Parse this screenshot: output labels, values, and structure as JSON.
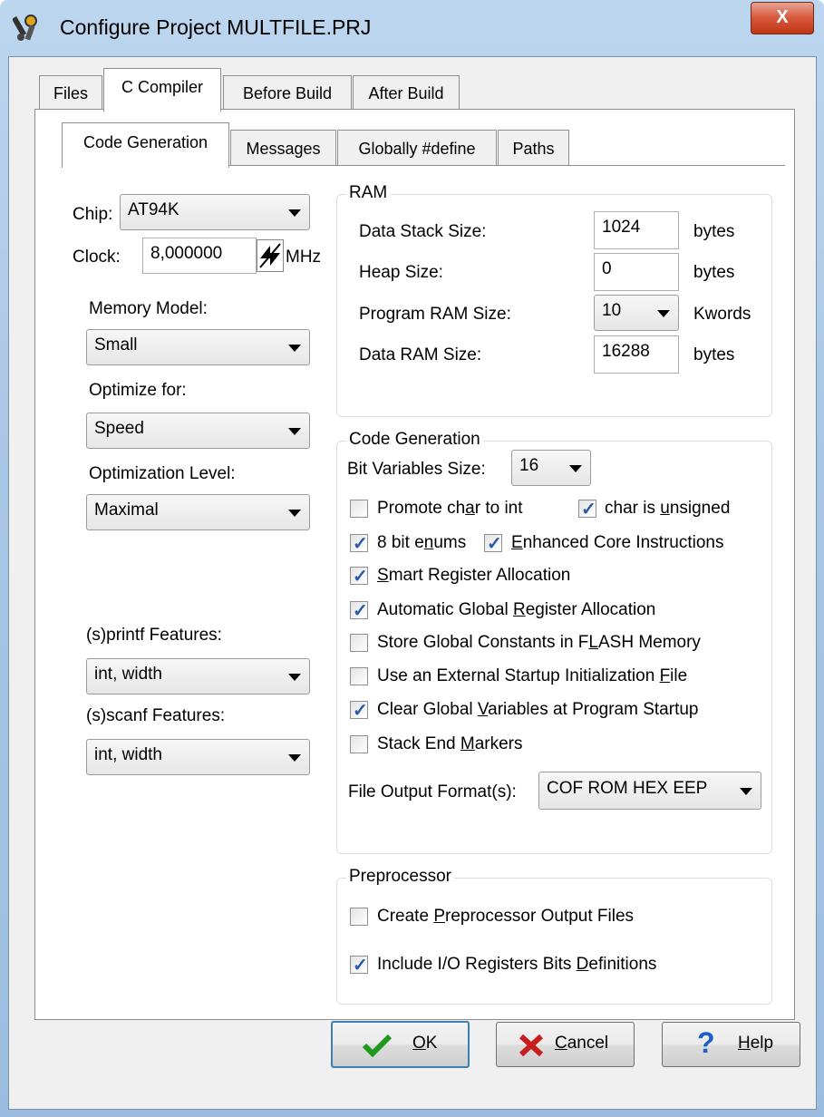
{
  "window": {
    "title": "Configure Project MULTFILE.PRJ",
    "close_glyph": "X"
  },
  "outer_tabs": [
    {
      "label": "Files"
    },
    {
      "label": "C Compiler"
    },
    {
      "label": "Before Build"
    },
    {
      "label": "After Build"
    }
  ],
  "inner_tabs": [
    {
      "label": "Code Generation"
    },
    {
      "label": "Messages"
    },
    {
      "label": "Globally #define"
    },
    {
      "label": "Paths"
    }
  ],
  "left": {
    "chip_label": "Chip:",
    "chip_value": "AT94K",
    "clock_label": "Clock:",
    "clock_value": "8,000000",
    "clock_unit": "MHz",
    "memory_model_label": "Memory Model:",
    "memory_model_value": "Small",
    "optimize_for_label": "Optimize for:",
    "optimize_for_value": "Speed",
    "opt_level_label": "Optimization Level:",
    "opt_level_value": "Maximal",
    "printf_label": "(s)printf Features:",
    "printf_value": "int, width",
    "scanf_label": "(s)scanf Features:",
    "scanf_value": "int, width"
  },
  "ram": {
    "title": "RAM",
    "rows": [
      {
        "label": "Data Stack Size:",
        "value": "1024",
        "unit": "bytes"
      },
      {
        "label": "Heap Size:",
        "value": "0",
        "unit": "bytes"
      },
      {
        "label": "Program RAM Size:",
        "value": "10",
        "unit": "Kwords"
      },
      {
        "label": "Data RAM Size:",
        "value": "16288",
        "unit": "bytes"
      }
    ]
  },
  "codegen": {
    "title": "Code Generation",
    "bitvar_label": "Bit Variables Size:",
    "bitvar_value": "16",
    "promote": {
      "pre": "Promote ch",
      "u": "a",
      "post": "r to int",
      "checked": false
    },
    "char_unsigned": {
      "pre": "char is ",
      "u": "u",
      "post": "nsigned",
      "checked": true
    },
    "enums8": {
      "pre": "8 bit e",
      "u": "n",
      "post": "ums",
      "checked": true
    },
    "enhanced": {
      "pre": "",
      "u": "E",
      "post": "nhanced Core Instructions",
      "checked": true
    },
    "smart_reg": {
      "pre": "",
      "u": "S",
      "post": "mart Register Allocation",
      "checked": true
    },
    "auto_global": {
      "pre": "Automatic Global ",
      "u": "R",
      "post": "egister Allocation",
      "checked": true
    },
    "store_const": {
      "pre": "Store Global Constants in F",
      "u": "L",
      "post": "ASH Memory",
      "checked": false
    },
    "ext_startup": {
      "pre": "Use an External Startup Initialization ",
      "u": "F",
      "post": "ile",
      "checked": false
    },
    "clear_globals": {
      "pre": "Clear Global ",
      "u": "V",
      "post": "ariables at Program Startup",
      "checked": true
    },
    "stack_end": {
      "pre": "Stack End ",
      "u": "M",
      "post": "arkers",
      "checked": false
    },
    "output_label": "File Output Format(s):",
    "output_value": "COF ROM HEX EEP"
  },
  "preprocessor": {
    "title": "Preprocessor",
    "create_files": {
      "pre": "Create ",
      "u": "P",
      "post": "reprocessor Output Files",
      "checked": false
    },
    "include_io": {
      "pre": "Include I/O Registers Bits ",
      "u": "D",
      "post": "efinitions",
      "checked": true
    }
  },
  "buttons": {
    "ok": {
      "u": "O",
      "post": "K"
    },
    "cancel": {
      "u": "C",
      "post": "ancel"
    },
    "help": {
      "u": "H",
      "post": "elp"
    }
  },
  "colors": {
    "check": "#2a5ba8",
    "ok_icon": "#1f9a1f",
    "cancel_icon": "#c81e1e",
    "help_icon": "#1d5fc8"
  },
  "icons": [
    "app-tools-icon",
    "close-icon",
    "spin-icon",
    "checkmark-icon",
    "x-icon",
    "question-icon"
  ]
}
